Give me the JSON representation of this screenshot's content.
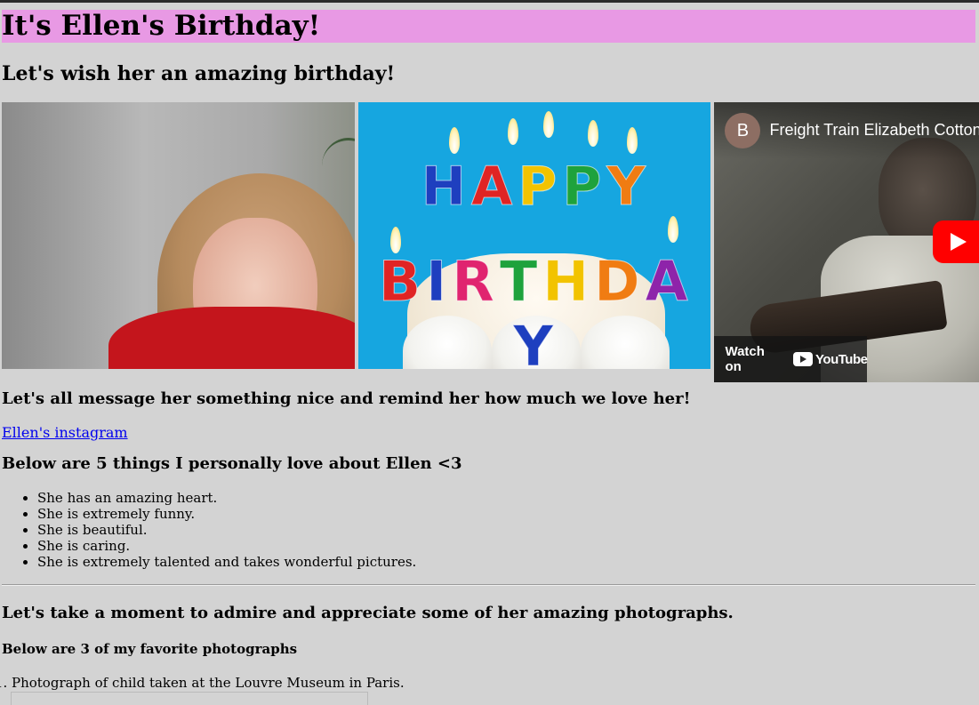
{
  "header": {
    "title": "It's Ellen's Birthday!",
    "subtitle": "Let's wish her an amazing birthday!"
  },
  "media": {
    "cake_line1": [
      "H",
      "A",
      "P",
      "P",
      "Y"
    ],
    "cake_line2": [
      "B",
      "I",
      "R",
      "T",
      "H",
      "D",
      "A",
      "Y"
    ],
    "cake_colors_line1": [
      "#1e3fbf",
      "#e02424",
      "#f2c300",
      "#1ea23c",
      "#f07c12"
    ],
    "cake_colors_line2": [
      "#e02424",
      "#1e3fbf",
      "#e0246f",
      "#1ea23c",
      "#f2c300",
      "#f07c12",
      "#8e24aa",
      "#1e3fbf"
    ],
    "video": {
      "channel_initial": "B",
      "title": "Freight Train Elizabeth Cotton",
      "watch_on": "Watch on",
      "youtube": "YouTube"
    }
  },
  "message_heading": "Let's all message her something nice and remind her how much we love her!",
  "instagram_link": "Ellen's instagram",
  "love_heading": "Below are 5 things I personally love about Ellen <3",
  "love_items": [
    "She has an amazing heart.",
    "She is extremely funny.",
    "She is beautiful.",
    "She is caring.",
    "She is extremely talented and takes wonderful pictures."
  ],
  "admire_heading": "Let's take a moment to admire and appreciate some of her amazing photographs.",
  "favorites_heading": "Below are 3 of my favorite photographs",
  "photo_items": [
    "Photograph of child taken at the Louvre Museum in Paris."
  ],
  "colors": {
    "background": "#d3d3d3",
    "title_band": "#e899e4",
    "link": "#0000ee",
    "cake_bg": "#16a6e0",
    "play_button": "#ff0000"
  }
}
